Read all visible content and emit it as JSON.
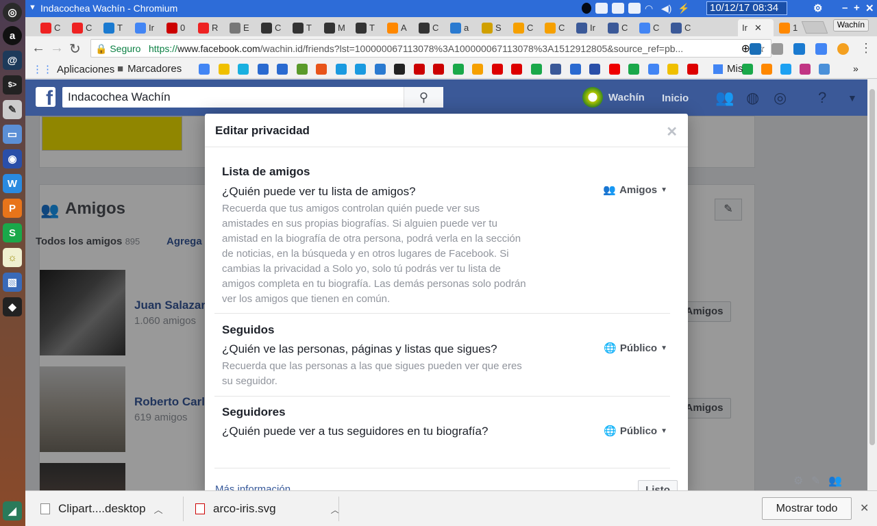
{
  "window": {
    "title": "Indacochea Wachín - Chromium",
    "clock": "10/12/17 08:34"
  },
  "tabstrip": {
    "active_tab_label": "Ir",
    "tab_labels": [
      "C",
      "C",
      "T",
      "Ir",
      "0",
      "R",
      "E",
      "C",
      "T",
      "M",
      "T",
      "A",
      "C",
      "a",
      "S",
      "C",
      "C",
      "Ir",
      "C",
      "C",
      "C"
    ],
    "last_tab_label": "1",
    "profile": "Wachín"
  },
  "toolbar": {
    "secure_label": "Seguro",
    "url_scheme": "https://",
    "url_host": "www.facebook.com",
    "url_path": "/wachin.id/friends?lst=100000067113078%3A100000067113078%3A1512912805&source_ref=pb..."
  },
  "bookmarks": {
    "apps": "Aplicaciones",
    "bookmarks_folder": "Marcadores",
    "mis": "Mis"
  },
  "facebook": {
    "search_value": "Indacochea Wachín",
    "user_name": "Wachín",
    "home": "Inicio",
    "section_title": "Amigos",
    "tab_all": "Todos los amigos",
    "tab_all_count": "895",
    "tab_add": "Agrega",
    "friends": [
      {
        "name": "Juan Salazar",
        "count": "1.060 amigos",
        "button": "Amigos"
      },
      {
        "name": "Roberto Carl",
        "count": "619 amigos",
        "button": "Amigos"
      }
    ]
  },
  "modal": {
    "title": "Editar privacidad",
    "sections": [
      {
        "title": "Lista de amigos",
        "question": "¿Quién puede ver tu lista de amigos?",
        "description": "Recuerda que tus amigos controlan quién puede ver sus amistades en sus propias biografías. Si alguien puede ver tu amistad en la biografía de otra persona, podrá verla en la sección de noticias, en la búsqueda y en otros lugares de Facebook. Si cambias la privacidad a Solo yo, solo tú podrás ver tu lista de amigos completa en tu biografía. Las demás personas solo podrán ver los amigos que tienen en común.",
        "audience": "Amigos"
      },
      {
        "title": "Seguidos",
        "question": "¿Quién ve las personas, páginas y listas que sigues?",
        "description": "Recuerda que las personas a las que sigues pueden ver que eres su seguidor.",
        "audience": "Público"
      },
      {
        "title": "Seguidores",
        "question": "¿Quién puede ver a tus seguidores en tu biografía?",
        "audience": "Público"
      }
    ],
    "more_info": "Más información",
    "done": "Listo"
  },
  "downloads": {
    "items": [
      {
        "name": "Clipart....desktop"
      },
      {
        "name": "arco-iris.svg"
      }
    ],
    "show_all": "Mostrar todo"
  },
  "colors": {
    "facebook_blue": "#3b5998",
    "titlebar_blue": "#2d6cd8",
    "link_blue": "#365899"
  }
}
